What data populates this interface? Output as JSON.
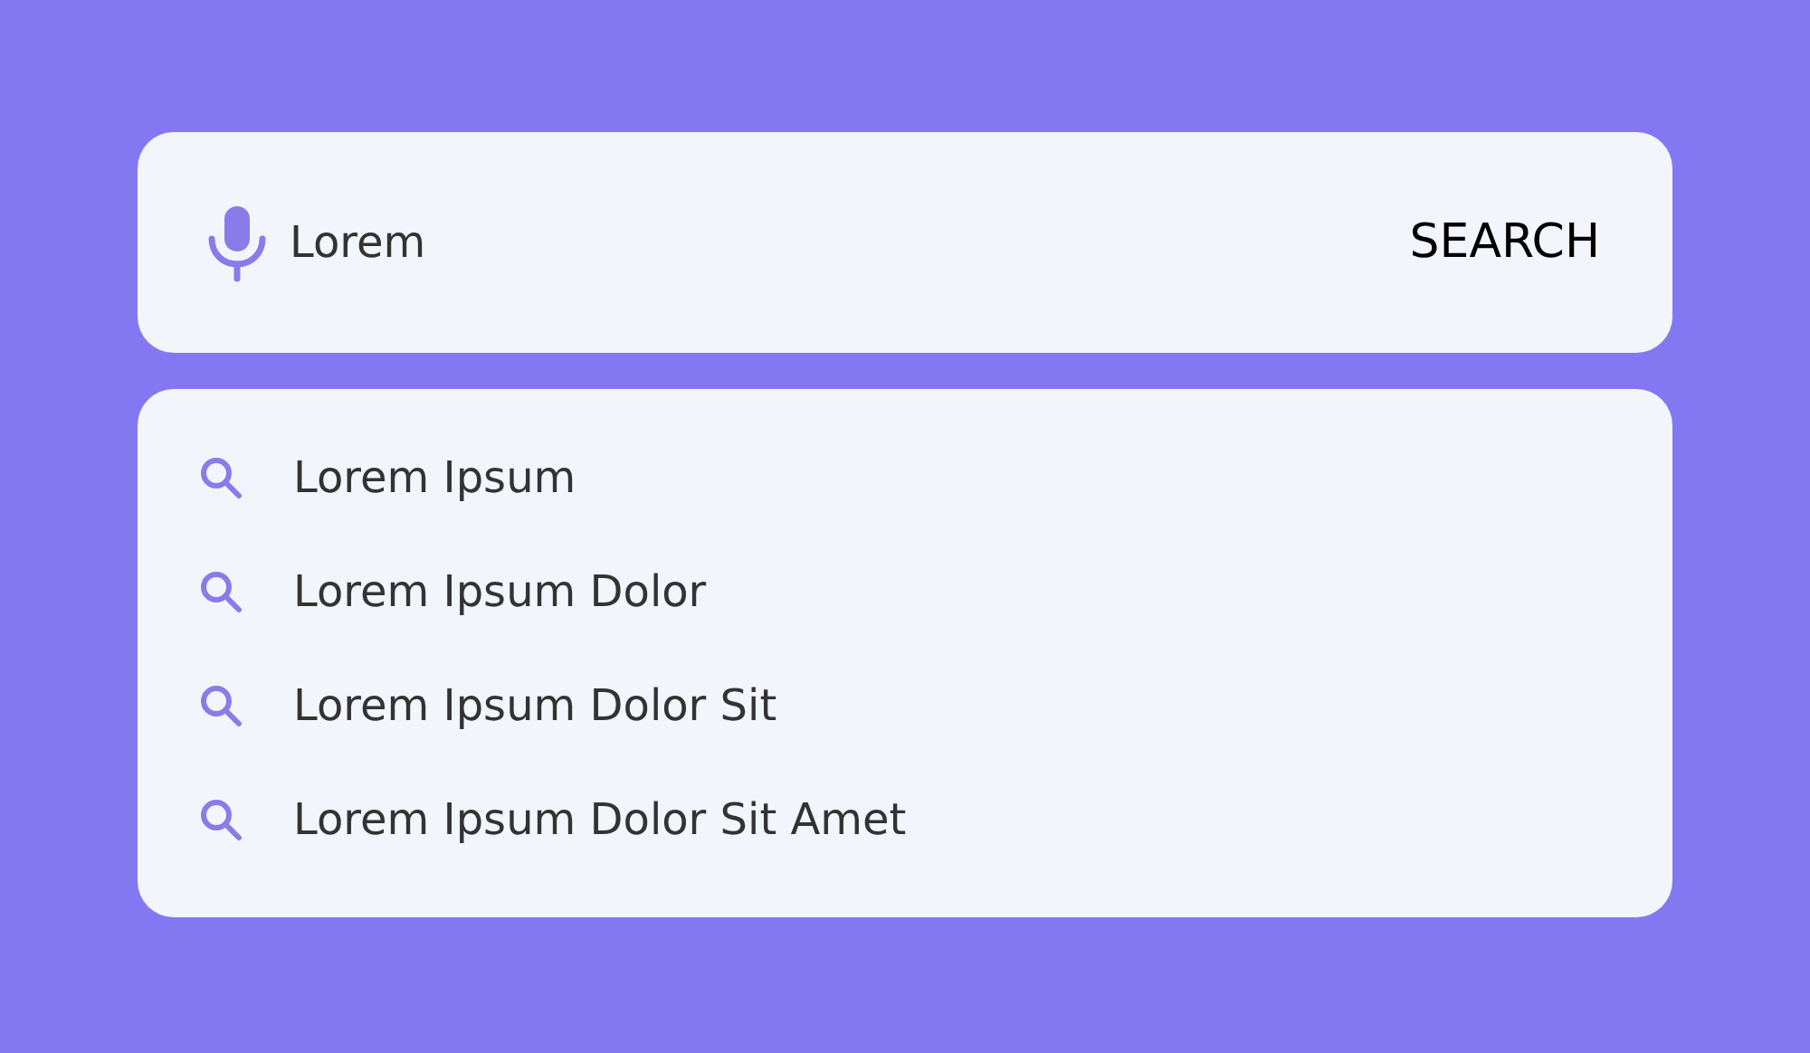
{
  "search_bar": {
    "value": "Lorem",
    "button": "SEARCH"
  },
  "suggestions": [
    {
      "text": "Lorem Ipsum"
    },
    {
      "text": "Lorem Ipsum Dolor"
    },
    {
      "text": "Lorem Ipsum Dolor Sit"
    },
    {
      "text": "Lorem Ipsum Dolor Sit Amet"
    }
  ]
}
